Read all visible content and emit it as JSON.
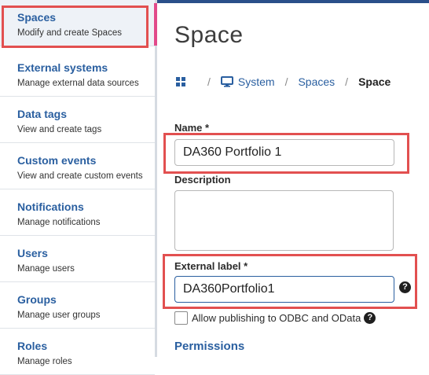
{
  "sidebar": {
    "items": [
      {
        "title": "Spaces",
        "subtitle": "Modify and create Spaces"
      },
      {
        "title": "External systems",
        "subtitle": "Manage external data sources"
      },
      {
        "title": "Data tags",
        "subtitle": "View and create tags"
      },
      {
        "title": "Custom events",
        "subtitle": "View and create custom events"
      },
      {
        "title": "Notifications",
        "subtitle": "Manage notifications"
      },
      {
        "title": "Users",
        "subtitle": "Manage users"
      },
      {
        "title": "Groups",
        "subtitle": "Manage user groups"
      },
      {
        "title": "Roles",
        "subtitle": "Manage roles"
      }
    ]
  },
  "page": {
    "title": "Space"
  },
  "breadcrumb": {
    "home_icon": "grid-icon",
    "system": "System",
    "spaces": "Spaces",
    "current": "Space"
  },
  "form": {
    "name_label": "Name *",
    "name_value": "DA360 Portfolio 1",
    "description_label": "Description",
    "description_value": "",
    "external_label": "External label *",
    "external_value": "DA360Portfolio1",
    "help_glyph": "?",
    "checkbox_label": "Allow publishing to ODBC and OData",
    "checkbox_checked": false,
    "permissions_title": "Permissions"
  },
  "colors": {
    "accent": "#2a5fa0",
    "highlight": "#e25050",
    "active_marker": "#e24a8a"
  }
}
